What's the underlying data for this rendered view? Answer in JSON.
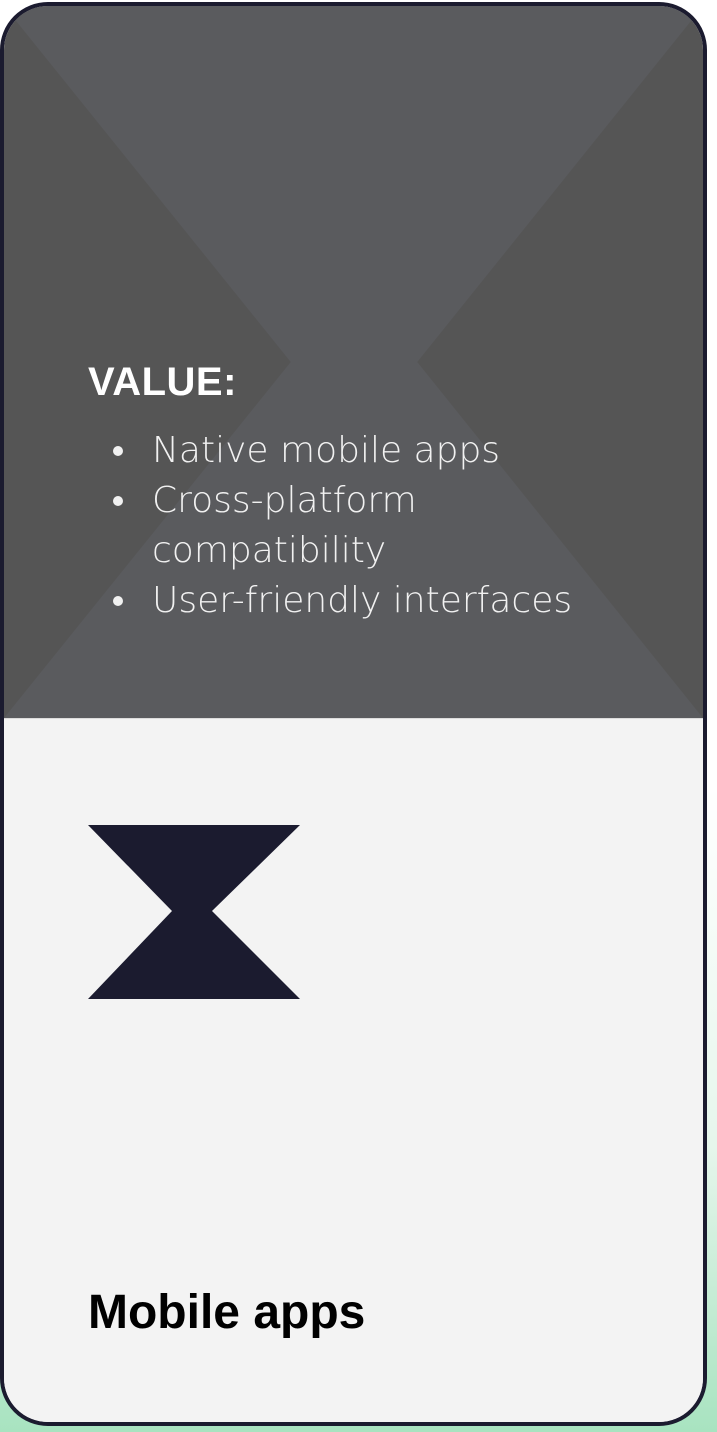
{
  "card": {
    "value_heading": "VALUE:",
    "value_items": [
      {
        "text": "Native mobile apps"
      },
      {
        "text": "Cross-platform compatibility"
      },
      {
        "text": "User-friendly interfaces"
      }
    ],
    "title": "Mobile apps",
    "logo_icon": "hourglass-logo-icon"
  },
  "colors": {
    "border": "#1b1b2f",
    "top_panel_dark": "#555555",
    "top_panel_light": "#5a5b5e",
    "bottom_panel": "#f3f3f3",
    "logo": "#1b1b2f",
    "text_light": "#f1f1f1",
    "accent_green": "#a8e3c0"
  }
}
